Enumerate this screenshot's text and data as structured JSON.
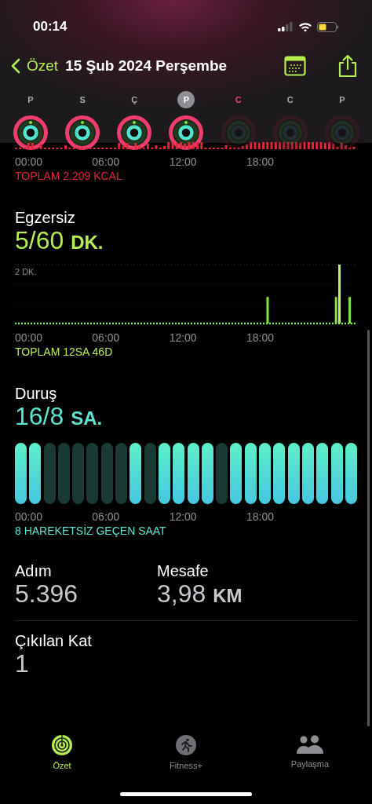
{
  "status_bar": {
    "time": "00:14"
  },
  "nav": {
    "back": "Özet",
    "title": "15 Şub 2024 Perşembe"
  },
  "days": [
    {
      "letter": "P",
      "selected": false,
      "today": false,
      "dimmed": false
    },
    {
      "letter": "S",
      "selected": false,
      "today": false,
      "dimmed": false
    },
    {
      "letter": "Ç",
      "selected": false,
      "today": false,
      "dimmed": false
    },
    {
      "letter": "P",
      "selected": true,
      "today": false,
      "dimmed": false
    },
    {
      "letter": "C",
      "selected": false,
      "today": true,
      "dimmed": true
    },
    {
      "letter": "C",
      "selected": false,
      "today": false,
      "dimmed": true
    },
    {
      "letter": "P",
      "selected": false,
      "today": false,
      "dimmed": true
    }
  ],
  "move": {
    "x_labels": [
      "00:00",
      "06:00",
      "12:00",
      "18:00"
    ],
    "total": "TOPLAM 2.209 KCAL"
  },
  "exercise": {
    "title": "Egzersiz",
    "value": "5/60",
    "unit": "DK.",
    "tick": "2 DK.",
    "x_labels": [
      "00:00",
      "06:00",
      "12:00",
      "18:00"
    ],
    "total": "TOPLAM 12SA 46D"
  },
  "stand": {
    "title": "Duruş",
    "value": "16/8",
    "unit": "SA.",
    "hours": [
      {
        "stood": true
      },
      {
        "stood": true
      },
      {
        "stood": false
      },
      {
        "stood": false
      },
      {
        "stood": false
      },
      {
        "stood": false
      },
      {
        "stood": false
      },
      {
        "stood": false
      },
      {
        "stood": true
      },
      {
        "stood": false
      },
      {
        "stood": true
      },
      {
        "stood": true
      },
      {
        "stood": true
      },
      {
        "stood": true
      },
      {
        "stood": false
      },
      {
        "stood": true
      },
      {
        "stood": true
      },
      {
        "stood": true
      },
      {
        "stood": true
      },
      {
        "stood": true
      },
      {
        "stood": true
      },
      {
        "stood": true
      },
      {
        "stood": true
      },
      {
        "stood": true
      }
    ],
    "x_labels": [
      "00:00",
      "06:00",
      "12:00",
      "18:00"
    ],
    "total": "8 HAREKETSİZ GEÇEN SAAT"
  },
  "stats": [
    {
      "label": "Adım",
      "value": "5.396"
    },
    {
      "label": "Mesafe",
      "value": "3,98",
      "unit": "KM"
    }
  ],
  "floors": {
    "label": "Çıkılan Kat",
    "value": "1"
  },
  "tabs": [
    {
      "label": "Özet",
      "kind": "rings",
      "selected": true
    },
    {
      "label": "Fitness+",
      "kind": "runner",
      "selected": false
    },
    {
      "label": "Paylaşma",
      "kind": "people",
      "selected": false
    }
  ]
}
